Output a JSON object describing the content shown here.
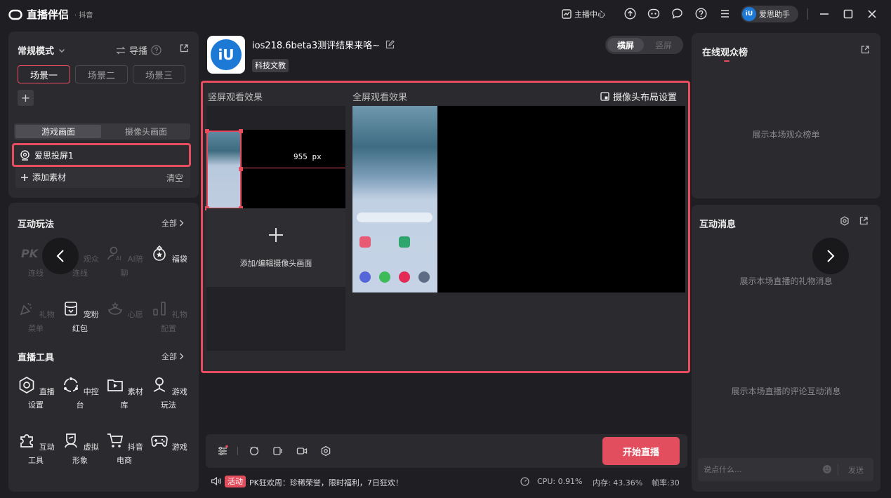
{
  "app": {
    "name": "直播伴侣",
    "platform": "· 抖音"
  },
  "titlebar": {
    "anchor_center": "主播中心",
    "user": "爱思助手"
  },
  "left": {
    "mode": "常规模式",
    "guide": "导播",
    "scenes": [
      "场景一",
      "场景二",
      "场景三"
    ],
    "add": "+",
    "tabs": [
      "游戏画面",
      "摄像头画面"
    ],
    "source": "爱思投屏1",
    "add_material": "添加素材",
    "clear": "清空"
  },
  "interactive": {
    "title": "互动玩法",
    "all": "全部",
    "items": [
      {
        "label": "PK连线",
        "icon": "pk-icon"
      },
      {
        "label": "观众连线",
        "icon": "audience-link-icon"
      },
      {
        "label": "AI陪聊",
        "icon": "ai-chat-icon"
      },
      {
        "label": "福袋",
        "icon": "lucky-bag-icon"
      },
      {
        "label": "礼物菜单",
        "icon": "gift-menu-icon"
      },
      {
        "label": "宠粉红包",
        "icon": "red-packet-icon"
      },
      {
        "label": "心愿",
        "icon": "wish-icon"
      },
      {
        "label": "礼物配置",
        "icon": "gift-config-icon"
      }
    ]
  },
  "tools": {
    "title": "直播工具",
    "all": "全部",
    "items": [
      {
        "label": "直播设置",
        "icon": "live-settings-icon"
      },
      {
        "label": "中控台",
        "icon": "control-center-icon"
      },
      {
        "label": "素材库",
        "icon": "material-library-icon"
      },
      {
        "label": "游戏玩法",
        "icon": "game-play-icon"
      },
      {
        "label": "互动工具",
        "icon": "puzzle-icon"
      },
      {
        "label": "虚拟形象",
        "icon": "avatar-icon"
      },
      {
        "label": "抖音电商",
        "icon": "cart-icon"
      },
      {
        "label": "游戏",
        "icon": "gamepad-icon"
      }
    ]
  },
  "stream": {
    "title": "ios218.6beta3测评结果来咯~",
    "category": "科技文教",
    "orient_on": "横屏",
    "orient_off": "竖屏"
  },
  "preview": {
    "vertical_label": "竖屏观看效果",
    "full_label": "全屏观看效果",
    "camera_layout": "摄像头布局设置",
    "measure": "955 px",
    "add_camera": "添加/编辑摄像头画面"
  },
  "bottom": {
    "start": "开始直播",
    "activity_badge": "活动",
    "activity_text": "PK狂欢周：珍稀荣誉，限时福利，7日狂欢！",
    "cpu": "CPU: 0.91%",
    "mem": "内存: 43.36%",
    "fps": "帧率:30"
  },
  "right": {
    "ranking_title": "在线观众榜",
    "ranking_empty": "展示本场观众榜单",
    "msg_title": "互动消息",
    "gift_empty": "展示本场直播的礼物消息",
    "comment_empty": "展示本场直播的评论互动消息",
    "input_placeholder": "说点什么...",
    "send": "发送"
  },
  "colors": {
    "accent": "#e74c5f",
    "panel": "#2b2a2e",
    "bg": "#1f1e22"
  }
}
